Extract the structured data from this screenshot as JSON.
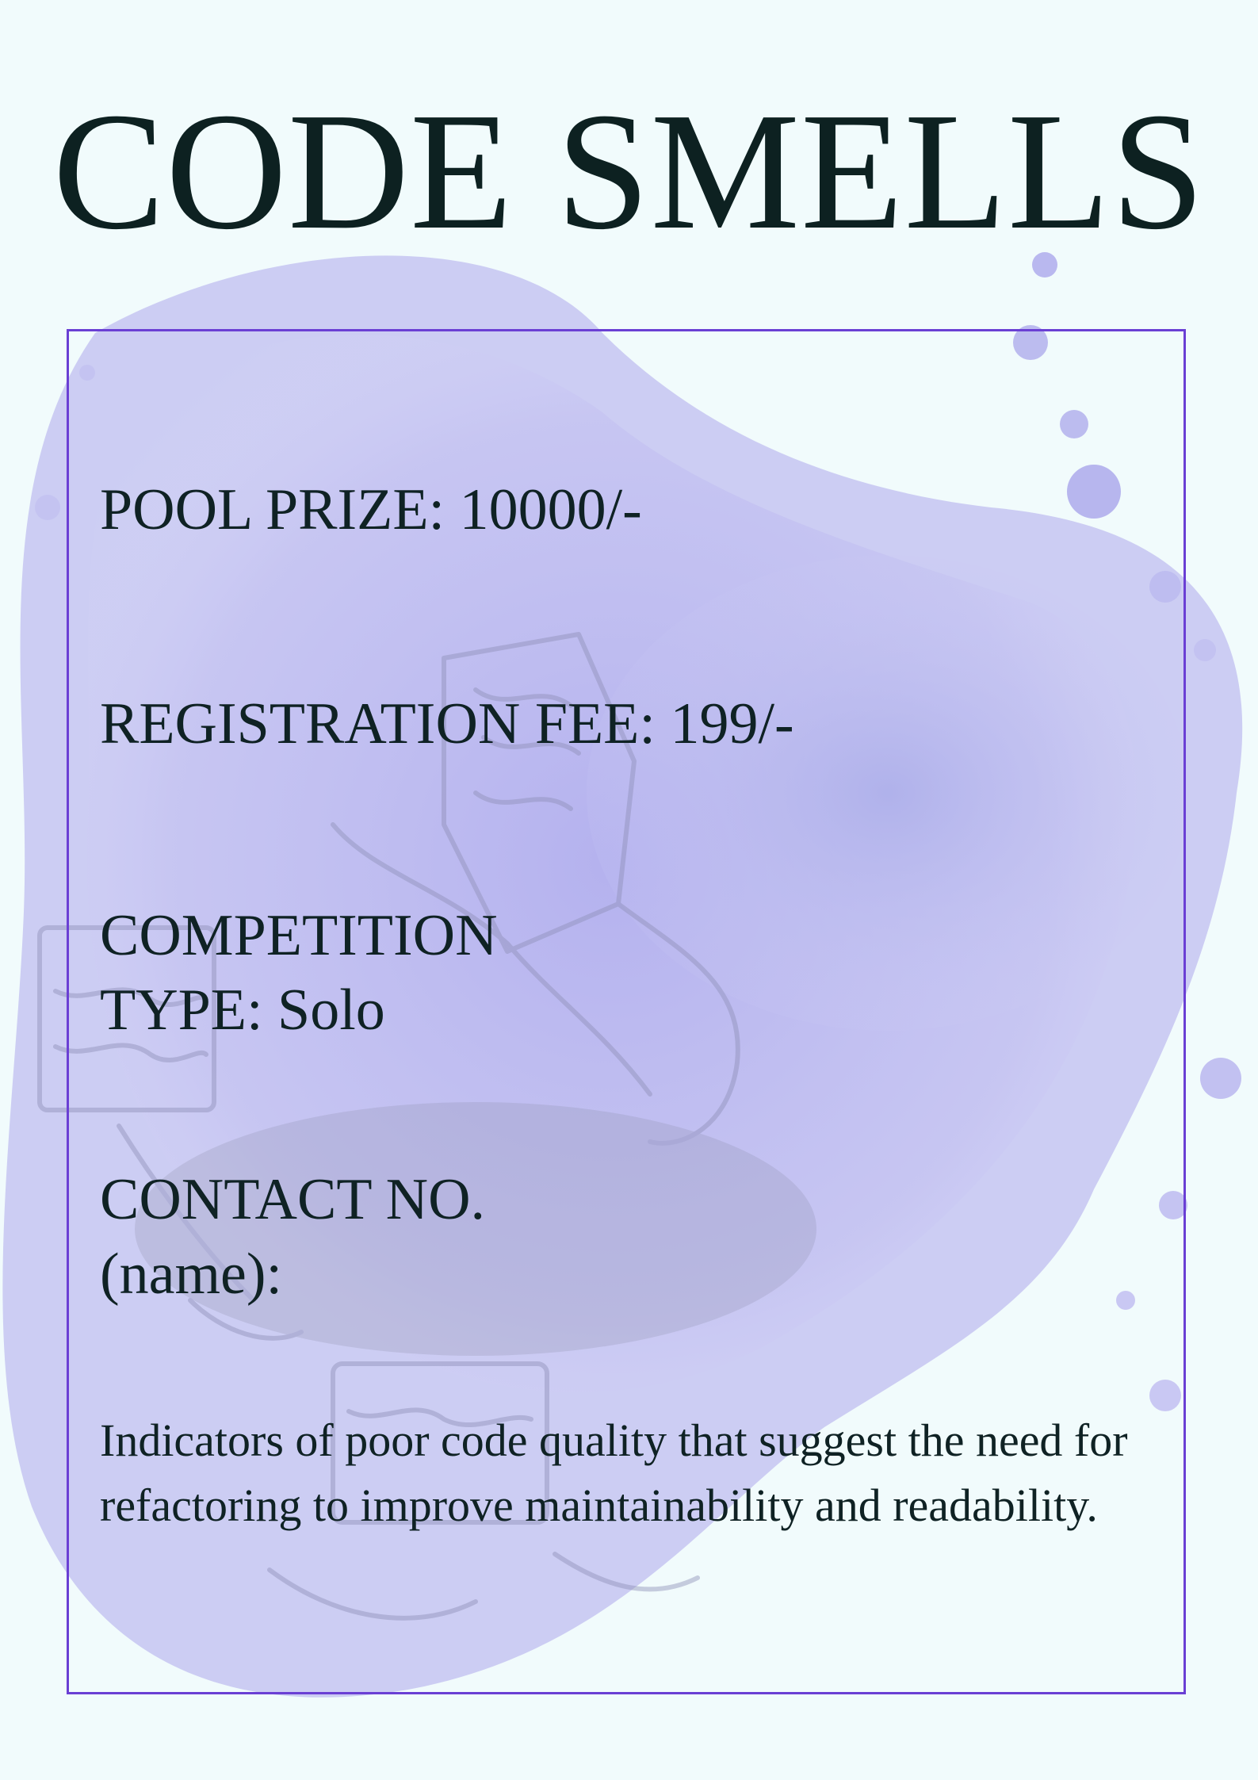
{
  "poster": {
    "title": "CODE SMELLS",
    "pool_prize": "POOL PRIZE:  10000/-",
    "registration_fee": "REGISTRATION FEE: 199/-",
    "competition_type_line1": "COMPETITION",
    "competition_type_line2": "TYPE: Solo",
    "contact_line1": "CONTACT NO.",
    "contact_line2": "(name):",
    "description": "Indicators of poor code quality that suggest the need for refactoring to improve maintainability and readability."
  },
  "colors": {
    "background": "#f1fbfc",
    "text": "#0f2224",
    "frame": "#6a3fd4",
    "watercolor": "#b9b8ef"
  }
}
